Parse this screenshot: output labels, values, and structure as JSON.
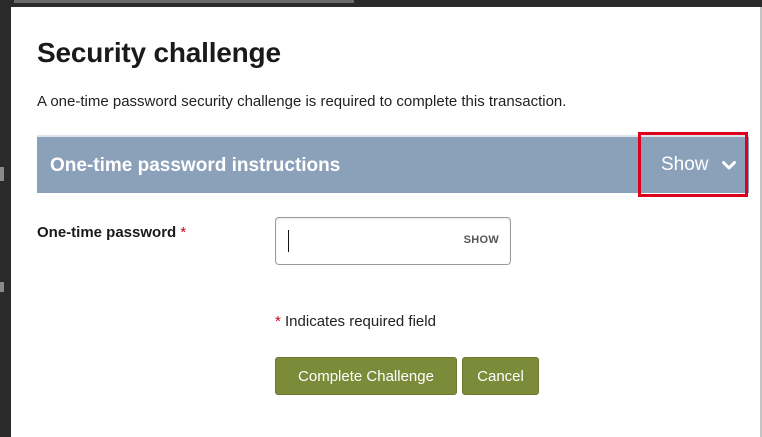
{
  "dialog": {
    "title": "Security challenge",
    "subtitle": "A one-time password security challenge is required to complete this transaction."
  },
  "instructions": {
    "title": "One-time password instructions",
    "toggle_label": "Show",
    "toggle_icon": "chevron-down-icon"
  },
  "form": {
    "otp_label": "One-time password",
    "required_marker": "*",
    "otp_value": "",
    "show_label": "SHOW",
    "required_note_marker": "*",
    "required_note_text": "Indicates required field"
  },
  "actions": {
    "complete_label": "Complete Challenge",
    "cancel_label": "Cancel"
  },
  "colors": {
    "header_bar": "#8ba1ba",
    "button": "#7b8b39",
    "highlight_box": "#e0001b",
    "required": "#d0021b"
  }
}
